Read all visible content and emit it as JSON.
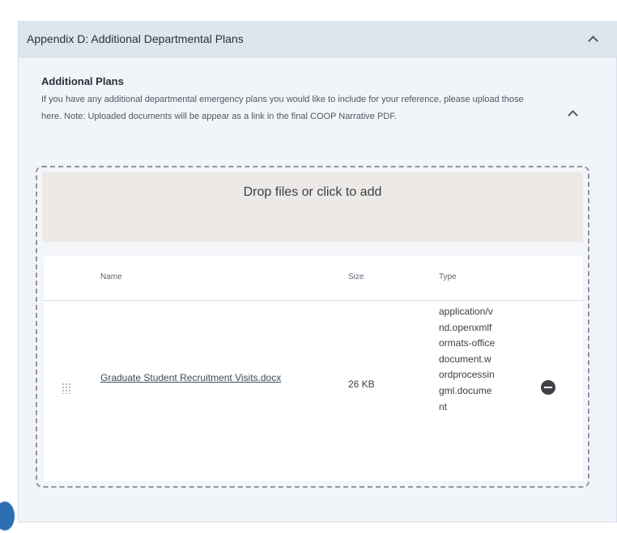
{
  "section": {
    "title": "Appendix D: Additional Departmental Plans",
    "collapse_icon": "chevron-up-icon"
  },
  "subsection": {
    "title": "Additional Plans",
    "description": "If you have any additional departmental emergency plans you would like to include for your reference, please upload those here. Note: Uploaded documents will be appear as a link in the final COOP Narrative PDF.",
    "collapse_icon": "chevron-up-icon"
  },
  "upload": {
    "drop_text": "Drop files or click to add"
  },
  "files_table": {
    "columns": [
      "Name",
      "Size",
      "Type"
    ],
    "rows": [
      {
        "name": "Graduate Student Recruitment Visits.docx",
        "size": "26 KB",
        "type": "application/vnd.openxmlformats-officedocument.wordprocessingml.document",
        "drag_icon": "drag-handle-icon",
        "remove_icon": "minus-circle-icon"
      }
    ]
  },
  "colors": {
    "header_bg": "#dde6ef",
    "panel_bg": "#f1f4f8",
    "drop_bg": "#ece9e6",
    "badge": "#2d6fb2"
  }
}
